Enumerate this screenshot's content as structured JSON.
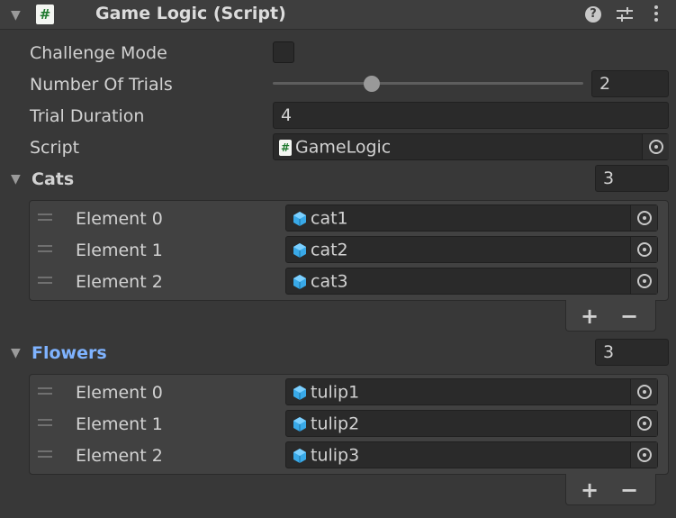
{
  "header": {
    "title": "Game Logic (Script)",
    "script_icon_glyph": "#",
    "help_glyph": "?",
    "icons": [
      "fold-arrow-icon",
      "script-icon",
      "help-icon",
      "presets-icon",
      "context-menu-icon"
    ]
  },
  "properties": {
    "challenge_mode": {
      "label": "Challenge Mode",
      "checked": false
    },
    "number_of_trials": {
      "label": "Number Of Trials",
      "value": "2",
      "slider_fraction": 0.32
    },
    "trial_duration": {
      "label": "Trial Duration",
      "value": "4"
    },
    "script": {
      "label": "Script",
      "value": "GameLogic"
    }
  },
  "cats": {
    "label": "Cats",
    "size": "3",
    "elements": [
      {
        "label": "Element 0",
        "value": "cat1"
      },
      {
        "label": "Element 1",
        "value": "cat2"
      },
      {
        "label": "Element 2",
        "value": "cat3"
      }
    ]
  },
  "flowers": {
    "label": "Flowers",
    "size": "3",
    "elements": [
      {
        "label": "Element 0",
        "value": "tulip1"
      },
      {
        "label": "Element 1",
        "value": "tulip2"
      },
      {
        "label": "Element 2",
        "value": "tulip3"
      }
    ]
  },
  "list_controls": {
    "add": "+",
    "remove": "−"
  },
  "colors": {
    "background": "#383838",
    "field": "#2a2a2a",
    "text": "#d2d2d2",
    "selected_label": "#7fb3ff",
    "cube_icon": "#39a9e8",
    "script_icon_green": "#1f7a2f"
  }
}
